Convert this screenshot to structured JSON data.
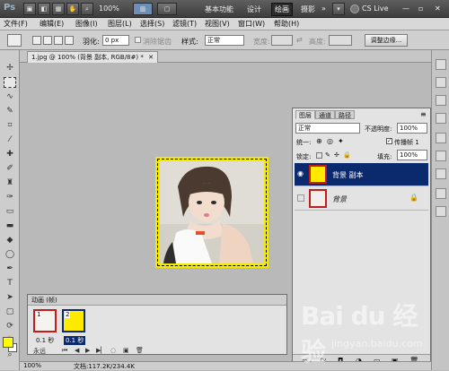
{
  "appbar": {
    "logo": "Ps",
    "zoom": "100%",
    "workspaces": [
      "基本功能",
      "设计",
      "绘画",
      "摄影"
    ],
    "active_workspace": "绘画",
    "more": "»",
    "cslive": "CS Live"
  },
  "menubar": {
    "items": [
      "文件(F)",
      "编辑(E)",
      "图像(I)",
      "图层(L)",
      "选择(S)",
      "滤镜(T)",
      "视图(V)",
      "窗口(W)",
      "帮助(H)"
    ]
  },
  "options": {
    "feather_label": "羽化:",
    "feather_value": "0 px",
    "antialias_label": "消除锯齿",
    "style_label": "样式:",
    "style_value": "正常",
    "width_label": "宽度:",
    "height_label": "高度:",
    "refine_edge": "调整边缘..."
  },
  "document": {
    "tab_title": "1.jpg @ 100% (背景 副本, RGB/8#) *"
  },
  "layers_panel": {
    "tabs": [
      "图层",
      "通道",
      "路径"
    ],
    "blend_mode": "正常",
    "opacity_label": "不透明度:",
    "opacity_value": "100%",
    "unify_label": "统一:",
    "propagate_label": "传播帧 1",
    "lock_label": "锁定:",
    "fill_label": "填充:",
    "fill_value": "100%",
    "layers": [
      {
        "name": "背景 副本",
        "selected": true,
        "visible": true
      },
      {
        "name": "背景",
        "selected": false,
        "visible": false
      }
    ]
  },
  "animation_panel": {
    "title": "动画 (帧)",
    "frames": [
      {
        "number": "1",
        "duration": "0.1 秒"
      },
      {
        "number": "2",
        "duration": "0.1 秒"
      }
    ],
    "loop": "永远"
  },
  "status": {
    "zoom": "100%",
    "doc_info": "文档:117.2K/234.4K"
  },
  "colors": {
    "foreground": "#ffff00",
    "background": "#ffffff",
    "selected_layer": "#0b2a6e",
    "canvas_frame": "#f3ea00"
  },
  "watermark": {
    "brand": "Bai du 经验",
    "url": "jingyan.baidu.com"
  }
}
